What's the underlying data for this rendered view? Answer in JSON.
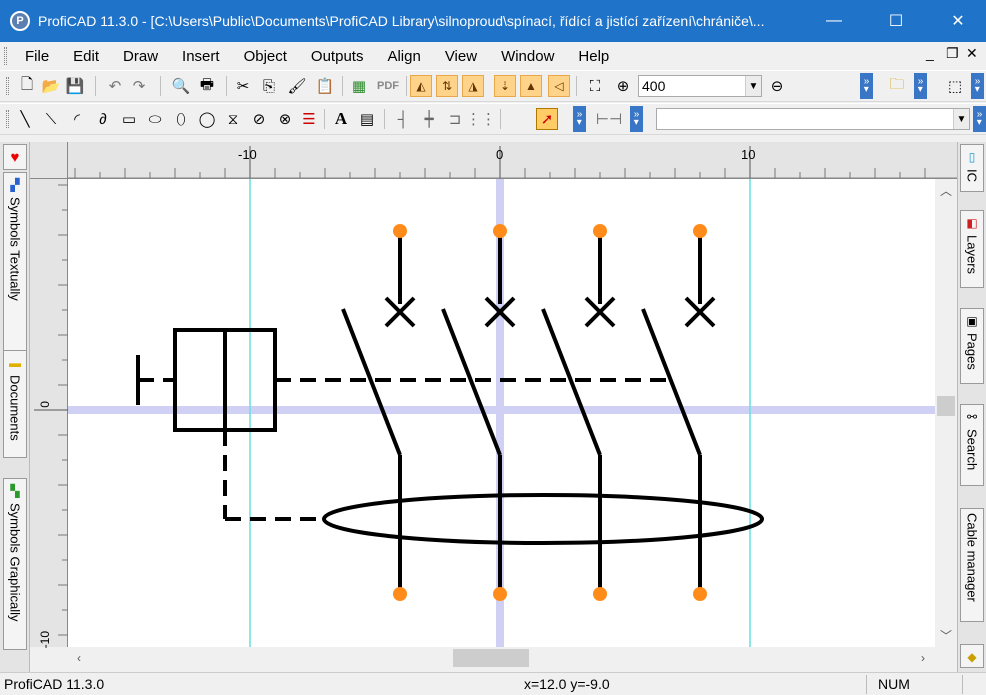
{
  "window": {
    "title": "ProfiCAD 11.3.0 - [C:\\Users\\Public\\Documents\\ProfiCAD Library\\silnoproud\\spínací, řídící a jistící zařízení\\chrániče\\...",
    "minimize_glyph": "—",
    "maximize_glyph": "☐",
    "close_glyph": "✕",
    "icon_letter": "P"
  },
  "menu": {
    "items": [
      "File",
      "Edit",
      "Draw",
      "Insert",
      "Object",
      "Outputs",
      "Align",
      "View",
      "Window",
      "Help"
    ],
    "mdi_min": "_",
    "mdi_restore": "❐",
    "mdi_close": "✕"
  },
  "toolbar1": {
    "zoom_value": "400",
    "pdf_label": "PDF"
  },
  "toolbar2": {
    "text_tool": "A",
    "layer_combo_value": ""
  },
  "left_tabs": [
    "Symbols Textually",
    "Documents",
    "Symbols Graphically"
  ],
  "right_tabs": [
    "IC",
    "Layers",
    "Pages",
    "Search",
    "Cable manager"
  ],
  "ruler": {
    "h_labels": [
      "-10",
      "0",
      "10"
    ],
    "v_labels": [
      "0",
      "-10"
    ]
  },
  "status": {
    "app": "ProfiCAD 11.3.0",
    "coords": "x=12.0  y=-9.0",
    "num": "NUM"
  },
  "colors": {
    "titlebar": "#1f73c9",
    "pin": "#ff8c1a",
    "axis": "#d0d0f4",
    "guide": "#66e0e0"
  }
}
